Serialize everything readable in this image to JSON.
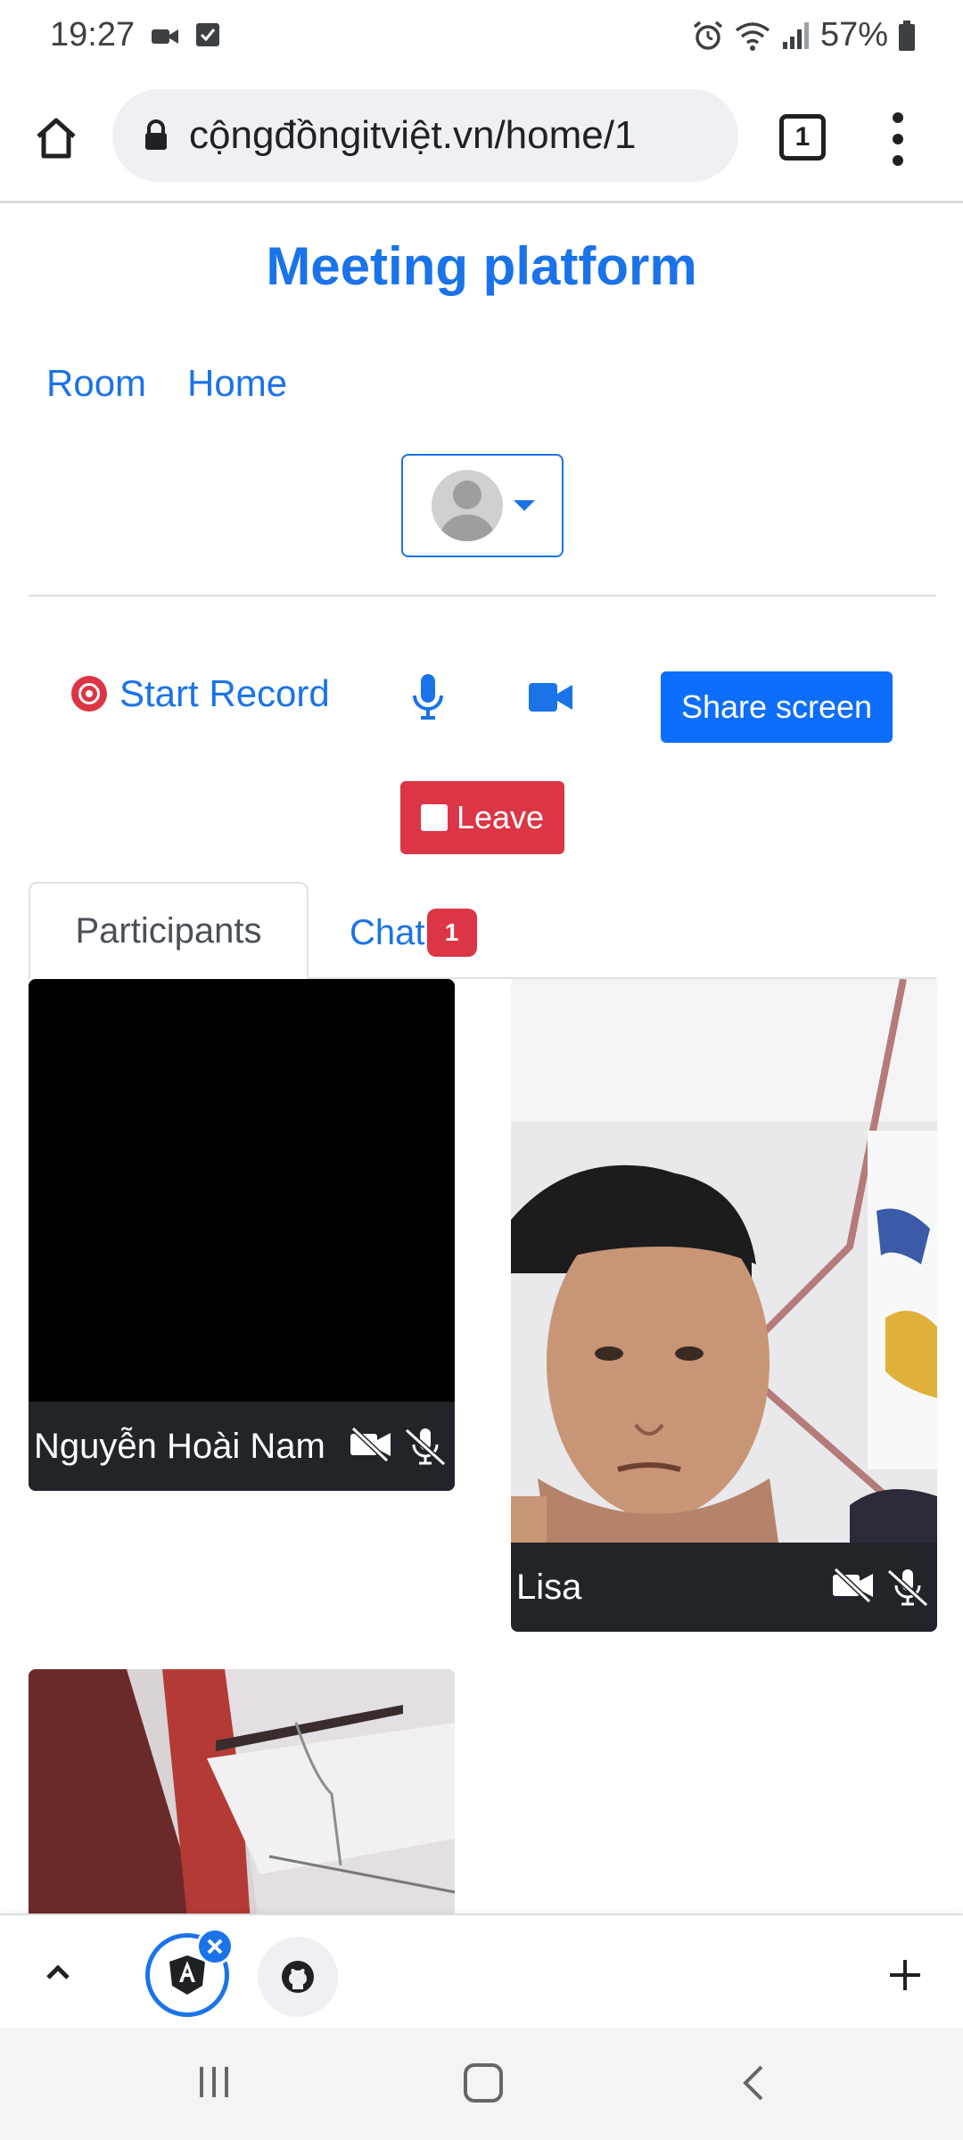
{
  "status_bar": {
    "time": "19:27",
    "battery": "57%",
    "icons": [
      "video-call-icon",
      "checkbox-icon",
      "alarm-icon",
      "wifi-icon",
      "signal-icon",
      "battery-icon"
    ]
  },
  "browser": {
    "url": "cộngđồngitviệt.vn/home/1",
    "tab_count": "1",
    "icons": [
      "home-icon",
      "lock-icon",
      "more-vert-icon"
    ]
  },
  "page": {
    "title": "Meeting platform",
    "nav": {
      "room": "Room",
      "home": "Home"
    }
  },
  "controls": {
    "start_record": "Start Record",
    "share_screen": "Share screen",
    "leave": "Leave",
    "icons": [
      "record-icon",
      "microphone-icon",
      "camera-icon",
      "stop-icon"
    ]
  },
  "tabs": {
    "participants": "Participants",
    "chat": "Chat",
    "chat_badge": "1"
  },
  "participants": [
    {
      "name": "Nguyễn Hoài Nam",
      "video_off": true,
      "mic_off": true
    },
    {
      "name": "Lisa",
      "video_off": true,
      "mic_off": true
    },
    {
      "name": "",
      "video_off": false,
      "mic_off": false
    }
  ],
  "bottom_bar": {
    "icons": [
      "chevron-up-icon",
      "angular-icon",
      "close-icon",
      "github-icon",
      "plus-icon"
    ]
  },
  "colors": {
    "primary": "#1a73e8",
    "button_blue": "#0d6efd",
    "danger": "#dc3545",
    "tile_dark": "#212529"
  }
}
